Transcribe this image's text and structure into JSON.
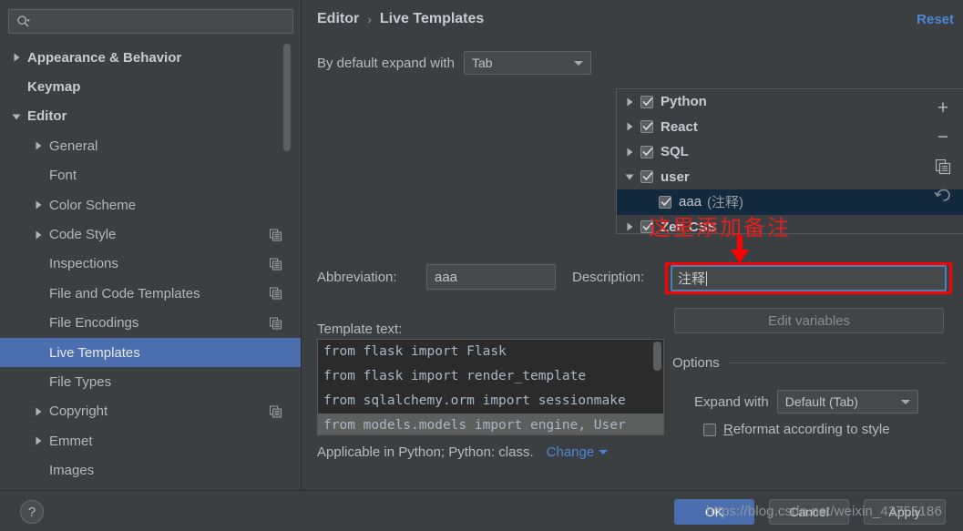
{
  "sidebar": {
    "search": {
      "placeholder": "",
      "value": "",
      "icon": "search-icon"
    },
    "items": [
      {
        "label": "Appearance & Behavior",
        "depth": 0,
        "arrow": "right",
        "bold": true,
        "selected": false,
        "copy": false
      },
      {
        "label": "Keymap",
        "depth": 0,
        "arrow": "none",
        "bold": true,
        "selected": false,
        "copy": false
      },
      {
        "label": "Editor",
        "depth": 0,
        "arrow": "down",
        "bold": true,
        "selected": false,
        "copy": false
      },
      {
        "label": "General",
        "depth": 1,
        "arrow": "right",
        "bold": false,
        "selected": false,
        "copy": false
      },
      {
        "label": "Font",
        "depth": 1,
        "arrow": "none",
        "bold": false,
        "selected": false,
        "copy": false
      },
      {
        "label": "Color Scheme",
        "depth": 1,
        "arrow": "right",
        "bold": false,
        "selected": false,
        "copy": false
      },
      {
        "label": "Code Style",
        "depth": 1,
        "arrow": "right",
        "bold": false,
        "selected": false,
        "copy": true
      },
      {
        "label": "Inspections",
        "depth": 1,
        "arrow": "none",
        "bold": false,
        "selected": false,
        "copy": true
      },
      {
        "label": "File and Code Templates",
        "depth": 1,
        "arrow": "none",
        "bold": false,
        "selected": false,
        "copy": true
      },
      {
        "label": "File Encodings",
        "depth": 1,
        "arrow": "none",
        "bold": false,
        "selected": false,
        "copy": true
      },
      {
        "label": "Live Templates",
        "depth": 1,
        "arrow": "none",
        "bold": false,
        "selected": true,
        "copy": false
      },
      {
        "label": "File Types",
        "depth": 1,
        "arrow": "none",
        "bold": false,
        "selected": false,
        "copy": false
      },
      {
        "label": "Copyright",
        "depth": 1,
        "arrow": "right",
        "bold": false,
        "selected": false,
        "copy": true
      },
      {
        "label": "Emmet",
        "depth": 1,
        "arrow": "right",
        "bold": false,
        "selected": false,
        "copy": false
      },
      {
        "label": "Images",
        "depth": 1,
        "arrow": "none",
        "bold": false,
        "selected": false,
        "copy": false
      }
    ]
  },
  "header": {
    "breadcrumb_parent": "Editor",
    "breadcrumb_sep": "›",
    "breadcrumb_current": "Live Templates",
    "reset_label": "Reset"
  },
  "expand_default": {
    "label": "By default expand with",
    "value": "Tab"
  },
  "templates_tree": {
    "rows": [
      {
        "label": "Python",
        "desc": "",
        "arrow": "right",
        "checked": true,
        "child": false,
        "selected": false
      },
      {
        "label": "React",
        "desc": "",
        "arrow": "right",
        "checked": true,
        "child": false,
        "selected": false
      },
      {
        "label": "SQL",
        "desc": "",
        "arrow": "right",
        "checked": true,
        "child": false,
        "selected": false
      },
      {
        "label": "user",
        "desc": "",
        "arrow": "down",
        "checked": true,
        "child": false,
        "selected": false
      },
      {
        "label": "aaa",
        "desc": "(注释)",
        "arrow": "none",
        "checked": true,
        "child": true,
        "selected": true
      },
      {
        "label": "Zen CSS",
        "desc": "",
        "arrow": "right",
        "checked": true,
        "child": false,
        "selected": false
      }
    ],
    "toolbar": [
      {
        "name": "add-template-button",
        "glyph": "+"
      },
      {
        "name": "remove-template-button",
        "glyph": "−"
      },
      {
        "name": "duplicate-template-button",
        "glyph": "copy"
      },
      {
        "name": "revert-template-button",
        "glyph": "undo"
      }
    ]
  },
  "annotation": {
    "text": "这里添加备注",
    "color": "#ff0000"
  },
  "form": {
    "abbreviation_label": "Abbreviation:",
    "abbreviation_value": "aaa",
    "description_label": "Description:",
    "description_value": "注释",
    "template_text_label": "Template text:",
    "code_lines": [
      {
        "text": "from flask import Flask",
        "selected": false
      },
      {
        "text": "from flask import render_template",
        "selected": false
      },
      {
        "text": "from sqlalchemy.orm import sessionmake",
        "selected": false
      },
      {
        "text": "from models.models import engine, User",
        "selected": true
      }
    ],
    "applicable_text": "Applicable in Python; Python: class.",
    "change_label": "Change"
  },
  "options": {
    "edit_variables_label": "Edit variables",
    "options_title": "Options",
    "expand_with_label": "Expand with",
    "expand_with_value": "Default (Tab)",
    "reformat_label_prefix": "",
    "reformat_label_underlined": "R",
    "reformat_label_rest": "eformat according to style",
    "reformat_checked": false
  },
  "footer": {
    "help_glyph": "?",
    "ok_label": "OK",
    "cancel_label": "Cancel",
    "apply_label": "Apply",
    "watermark": "https://blog.csdn.net/weixin_43755186"
  },
  "colors": {
    "window_bg": "#3c3f41",
    "selection_blue": "#4b6eaf",
    "tree_selection": "#13293d",
    "link_blue": "#4d87d8",
    "annotation_red": "#ff0000",
    "code_bg": "#2b2b2b"
  }
}
